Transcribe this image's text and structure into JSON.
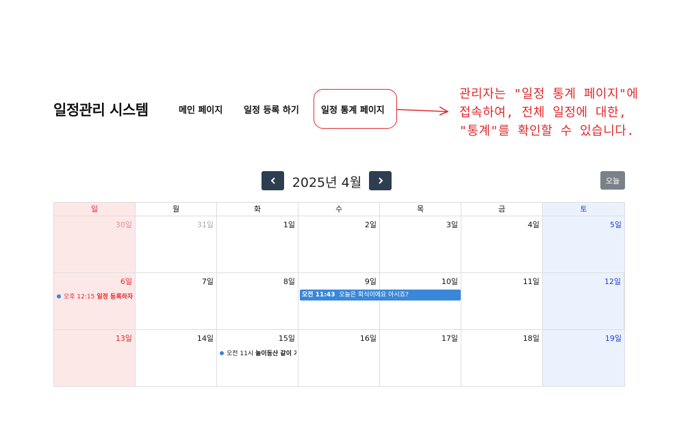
{
  "header": {
    "brand": "일정관리 시스템",
    "nav": {
      "main": "메인 페이지",
      "register": "일정 등록 하기",
      "stats": "일정 통계 페이지"
    }
  },
  "annotation": {
    "lines": [
      "관리자는 \"일정 통계 페이지\"에",
      "접속하여, 전체 일정에 대한,",
      "\"통계\"를 확인할 수 있습니다."
    ],
    "color": "#e0282c"
  },
  "calendar": {
    "title": "2025년 4월",
    "today_label": "오늘",
    "prev_icon": "chevron-left-icon",
    "next_icon": "chevron-right-icon",
    "weekdays": [
      "일",
      "월",
      "화",
      "수",
      "목",
      "금",
      "토"
    ],
    "weeks": [
      [
        "30일",
        "31일",
        "1일",
        "2일",
        "3일",
        "4일",
        "5일"
      ],
      [
        "6일",
        "7일",
        "8일",
        "9일",
        "10일",
        "11일",
        "12일"
      ],
      [
        "13일",
        "14일",
        "15일",
        "16일",
        "17일",
        "18일",
        "19일"
      ]
    ],
    "events": {
      "apr6": {
        "time": "오후 12:15",
        "title": "일정 등록하자"
      },
      "apr9_10": {
        "time": "오전 11:43",
        "title": "오늘은 회식이에요 아시죠?"
      },
      "apr15": {
        "time": "오전 11시",
        "title": "놀이동산 같이 가"
      }
    },
    "colors": {
      "sunday": "#e0282c",
      "saturday": "#1f3fd6",
      "event": "#3a87d9",
      "nav_button": "#2c3e50",
      "today_button": "#7a8189"
    }
  }
}
